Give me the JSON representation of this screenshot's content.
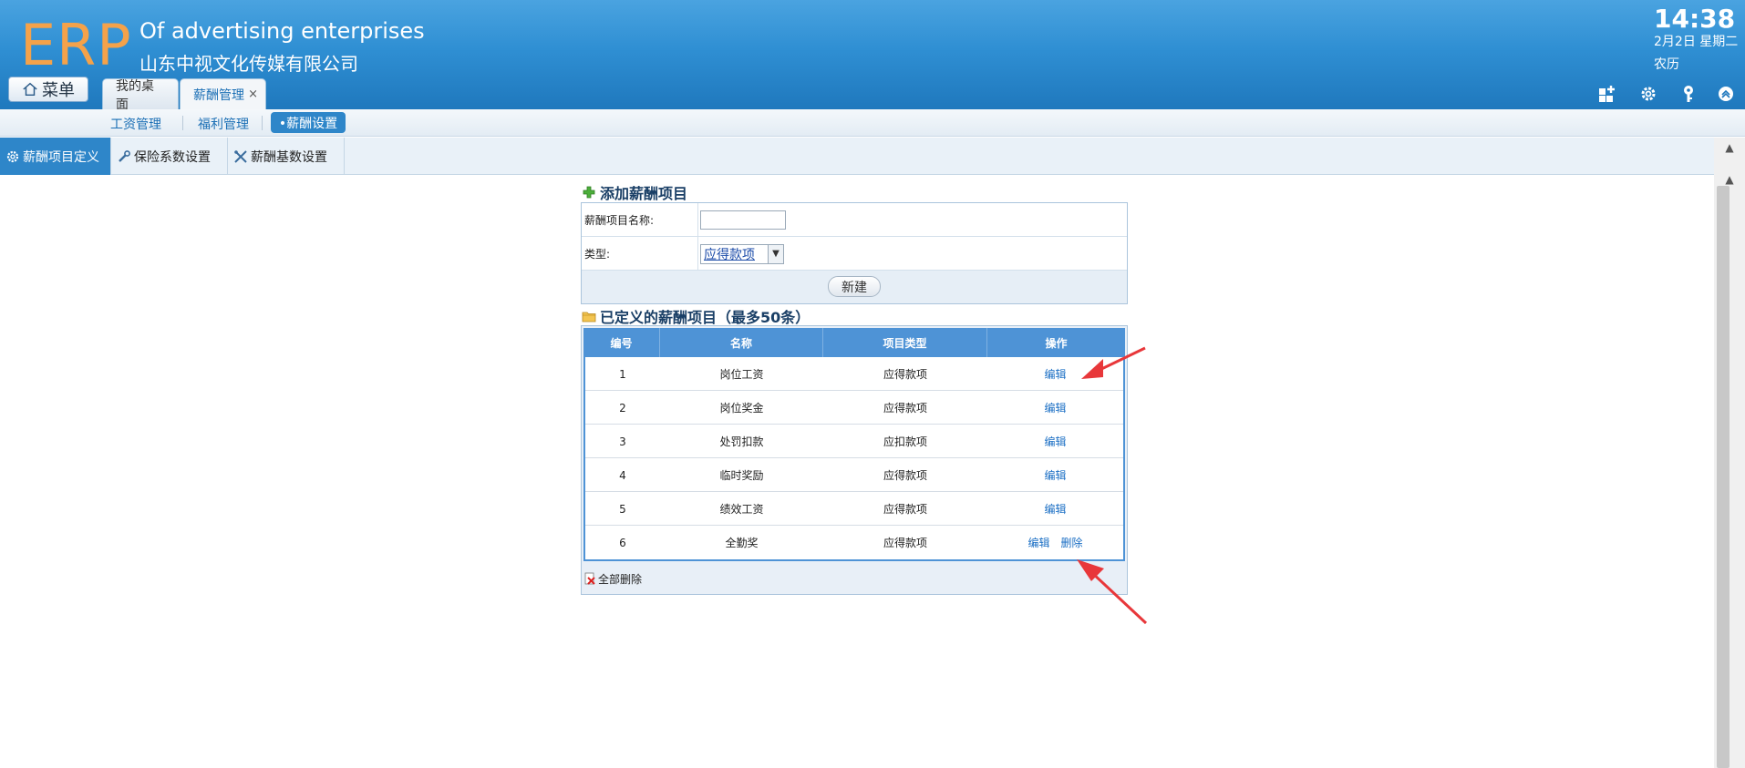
{
  "header": {
    "logo": "ERP",
    "title_en": "Of advertising enterprises",
    "title_cn": "山东中视文化传媒有限公司",
    "time": "14:38",
    "date": "2月2日 星期二",
    "lunar": "农历",
    "menu_label": "菜单",
    "tabs": [
      {
        "label": "我的桌面"
      },
      {
        "label": "薪酬管理",
        "close": "×"
      }
    ]
  },
  "subnav": {
    "items": [
      "工资管理",
      "福利管理"
    ],
    "active": "•薪酬设置"
  },
  "section_tabs": [
    "薪酬项目定义",
    "保险系数设置",
    "薪酬基数设置"
  ],
  "add_form": {
    "title": "添加薪酬项目",
    "name_label": "薪酬项目名称:",
    "name_value": "",
    "type_label": "类型:",
    "type_value": "应得款项",
    "submit_label": "新建"
  },
  "list": {
    "title": "已定义的薪酬项目（最多50条）",
    "columns": [
      "编号",
      "名称",
      "项目类型",
      "操作"
    ],
    "rows": [
      {
        "no": "1",
        "name": "岗位工资",
        "type": "应得款项",
        "edit": "编辑"
      },
      {
        "no": "2",
        "name": "岗位奖金",
        "type": "应得款项",
        "edit": "编辑"
      },
      {
        "no": "3",
        "name": "处罚扣款",
        "type": "应扣款项",
        "edit": "编辑"
      },
      {
        "no": "4",
        "name": "临时奖励",
        "type": "应得款项",
        "edit": "编辑"
      },
      {
        "no": "5",
        "name": "绩效工资",
        "type": "应得款项",
        "edit": "编辑"
      },
      {
        "no": "6",
        "name": "全勤奖",
        "type": "应得款项",
        "edit": "编辑",
        "delete": "删除"
      }
    ],
    "delete_all": "全部删除"
  },
  "colors": {
    "header_blue": "#2f8fd3",
    "logo_orange": "#f4a24a",
    "active_tab": "#2e86c9",
    "table_header": "#4e93d6",
    "link": "#1a6ec4",
    "annotation_arrow": "#e8373a"
  },
  "icons": [
    "home-icon",
    "add-module-icon",
    "settings-gear-icon",
    "key-icon",
    "collapse-up-icon",
    "plus-icon",
    "folder-icon",
    "gear-icon",
    "wrench-icon",
    "tools-icon",
    "delete-all-icon"
  ]
}
